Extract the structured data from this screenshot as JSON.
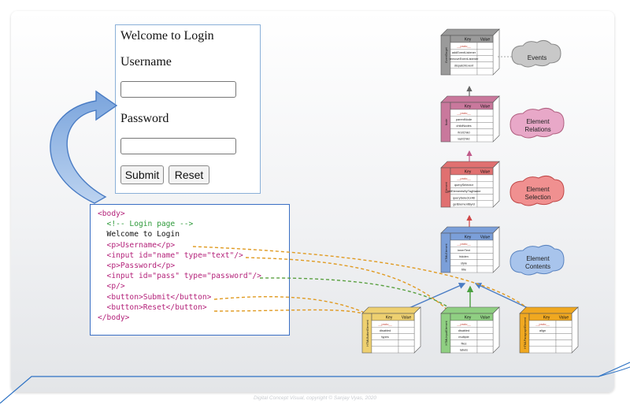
{
  "login_form": {
    "title": "Welcome to Login",
    "username_label": "Username",
    "password_label": "Password",
    "submit_label": "Submit",
    "reset_label": "Reset"
  },
  "code": {
    "lines": [
      "<body>",
      "  <!-- Login page -->",
      "  Welcome to Login",
      "  <p>Username</p>",
      "  <input id=\"name\" type=\"text\"/>",
      "  <p>Password</p>",
      "  <input id=\"pass\" type=\"password\"/>",
      "  <p/>",
      "  <button>Submit</button>",
      "  <button>Reset</button>",
      "</body>"
    ]
  },
  "tables": {
    "event_target": {
      "title": "EventTarget",
      "color": "#9a9a9a",
      "header": [
        "Key",
        "Value"
      ],
      "rows": [
        "__proto__",
        "addEventListener",
        "removeEventListener",
        "dispatchEvent",
        ""
      ]
    },
    "node": {
      "title": "Node",
      "color": "#c9789c",
      "header": [
        "Key",
        "Value"
      ],
      "rows": [
        "__proto__",
        "parentNode",
        "childNodes",
        "firstChild",
        "lastChild"
      ]
    },
    "element": {
      "title": "Element",
      "color": "#e07070",
      "header": [
        "Key",
        "Value"
      ],
      "rows": [
        "__proto__",
        "querySelector",
        "getElementsByTagName",
        "querySelectorAll",
        "getElementById"
      ]
    },
    "html_element": {
      "title": "HTMLElement",
      "color": "#7b9fd9",
      "header": [
        "Key",
        "Value"
      ],
      "rows": [
        "__proto__",
        "innerText",
        "hidden",
        "style",
        "title"
      ]
    },
    "html_button": {
      "title": "HTMLButtonElement",
      "color": "#eed070",
      "header": [
        "Key",
        "Value"
      ],
      "rows": [
        "__proto__",
        "disabled",
        "types",
        "",
        ""
      ]
    },
    "html_input": {
      "title": "HTMLInputElement",
      "color": "#8fcf82",
      "header": [
        "Key",
        "Value"
      ],
      "rows": [
        "__proto__",
        "disabled",
        "multiple",
        "files",
        "labels"
      ]
    },
    "html_paragraph": {
      "title": "HTMLParagraphElement",
      "color": "#f0a820",
      "header": [
        "Key",
        "Value"
      ],
      "rows": [
        "__proto__",
        "align",
        "",
        "",
        ""
      ]
    }
  },
  "clouds": {
    "events": "Events",
    "element_relations": "Element Relations",
    "element_selection": "Element Selection",
    "element_contents": "Element Contents"
  },
  "copyright": "Digital Concept Visual, copyright © Sanjay Vyas, 2020"
}
